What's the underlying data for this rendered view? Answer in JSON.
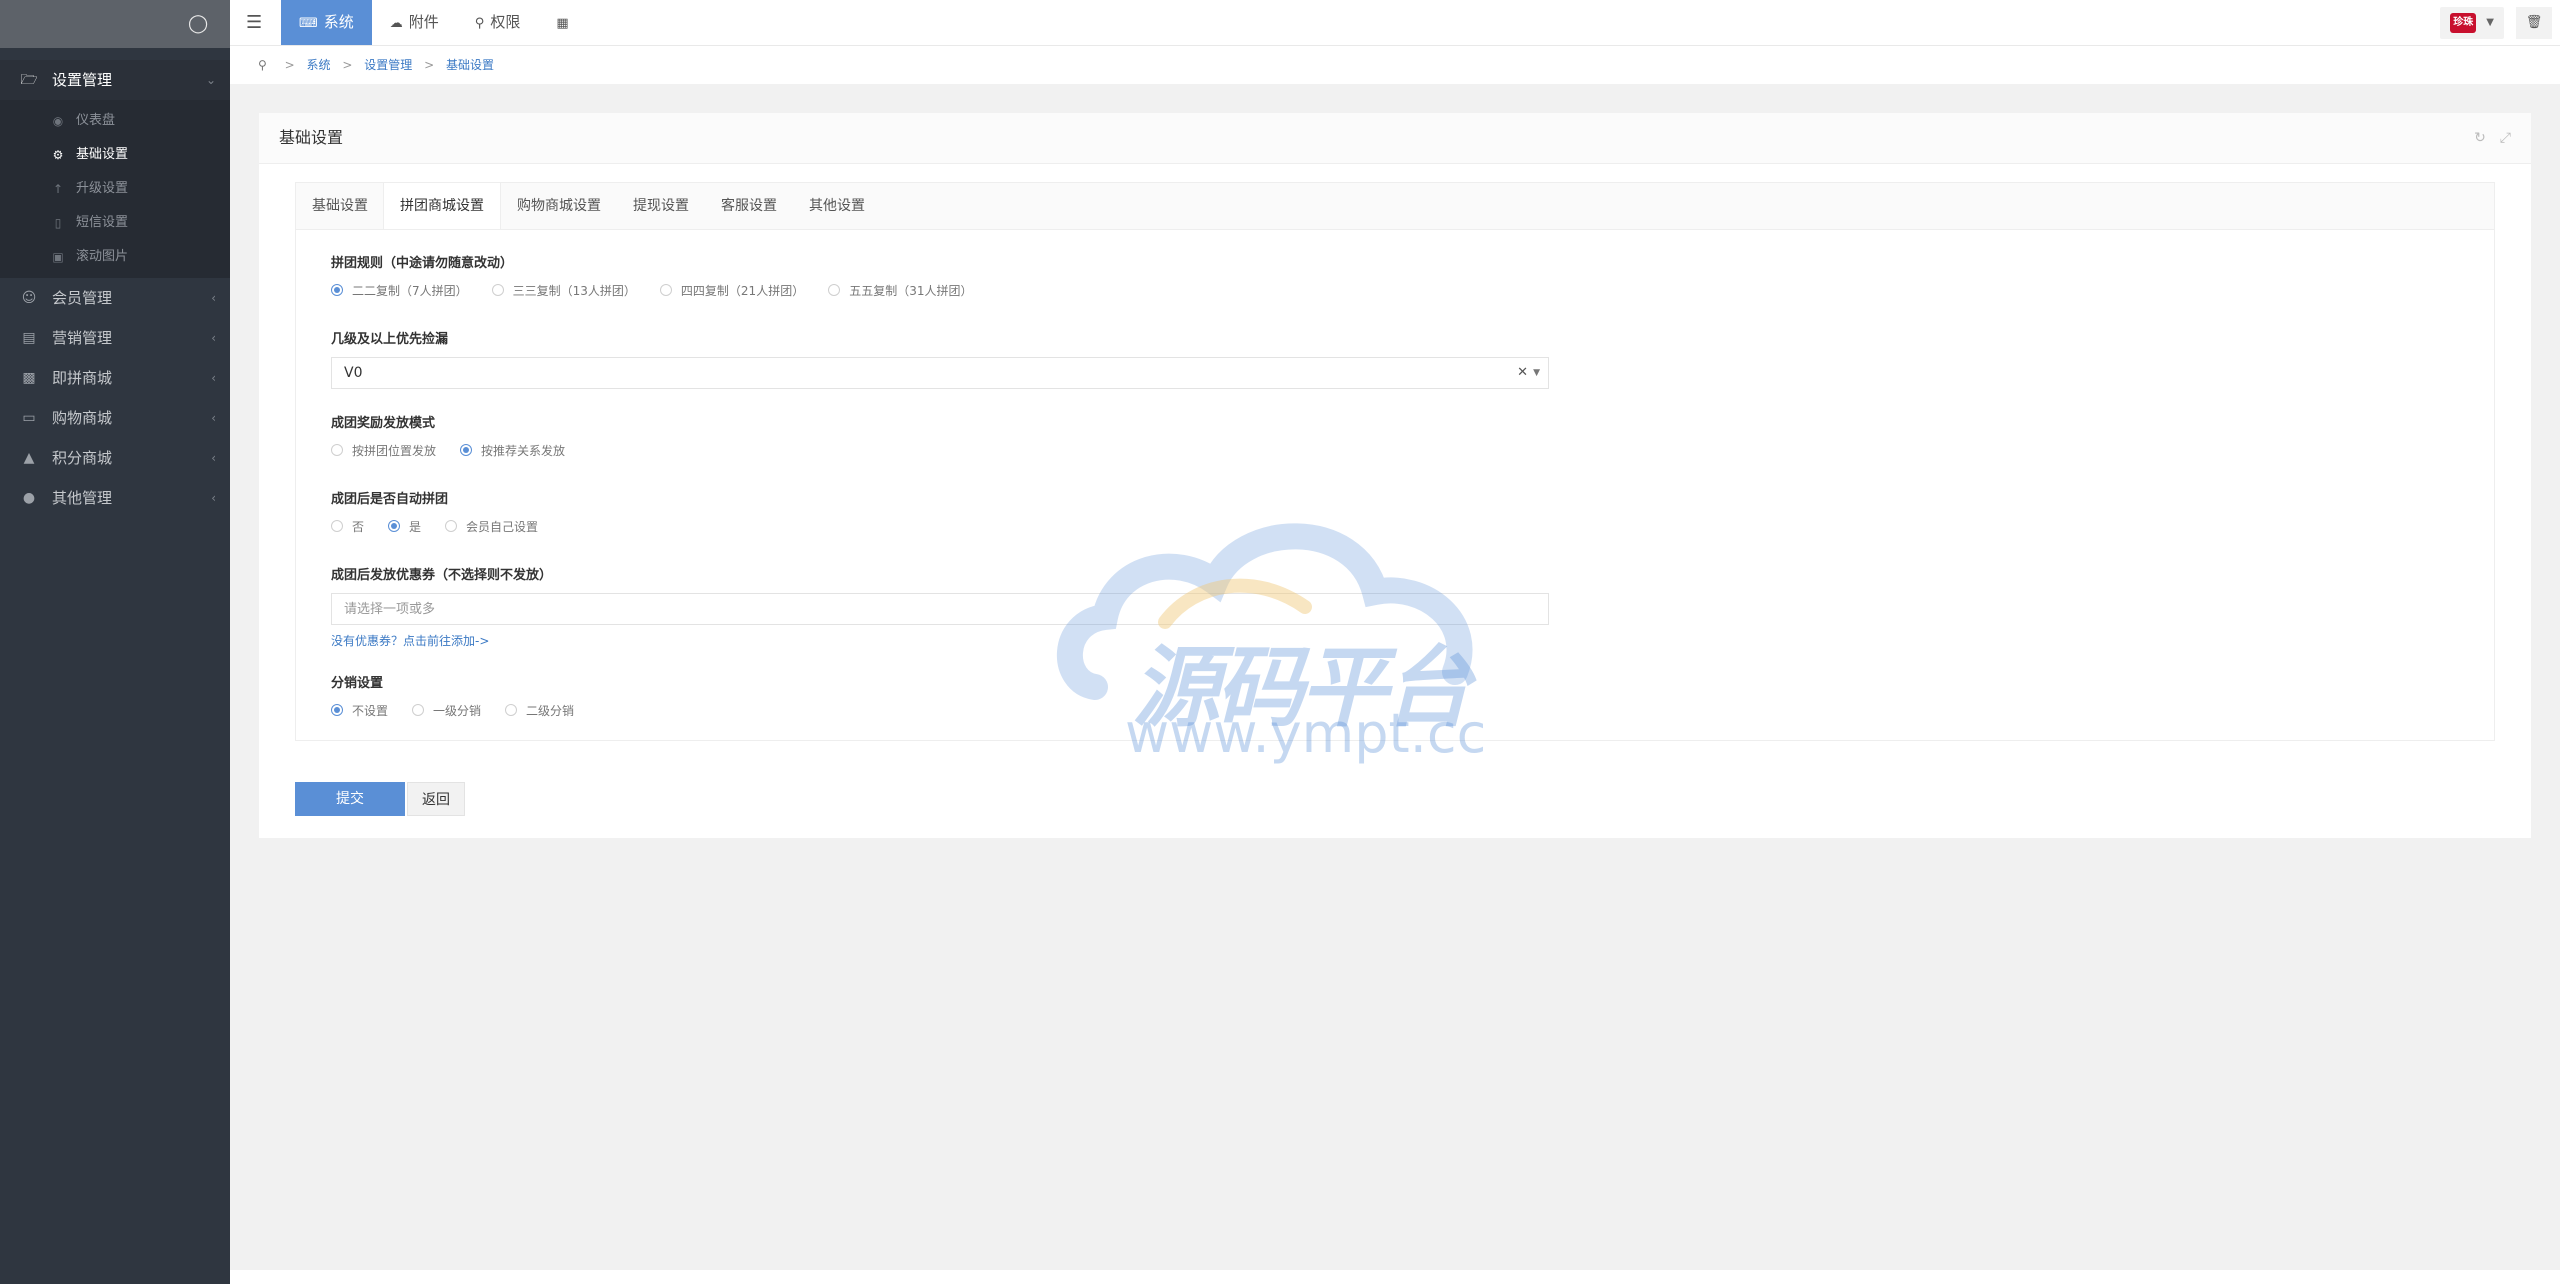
{
  "sidebar": {
    "groups": [
      {
        "label": "设置管理",
        "icon": "folder-open-icon"
      },
      {
        "label": "会员管理",
        "icon": "user-icon"
      },
      {
        "label": "营销管理",
        "icon": "money-icon"
      },
      {
        "label": "即拼商城",
        "icon": "bank-icon"
      },
      {
        "label": "购物商城",
        "icon": "cart-icon"
      },
      {
        "label": "积分商城",
        "icon": "building-icon"
      },
      {
        "label": "其他管理",
        "icon": "chat-icon"
      }
    ],
    "sub_items": [
      {
        "label": "仪表盘",
        "icon": "dashboard-icon"
      },
      {
        "label": "基础设置",
        "icon": "gear-icon"
      },
      {
        "label": "升级设置",
        "icon": "arrow-up-icon"
      },
      {
        "label": "短信设置",
        "icon": "phone-icon"
      },
      {
        "label": "滚动图片",
        "icon": "image-icon"
      }
    ]
  },
  "topbar": {
    "nav": [
      {
        "label": "系统",
        "icon": "keyboard-icon"
      },
      {
        "label": "附件",
        "icon": "cloud-icon"
      },
      {
        "label": "权限",
        "icon": "key-icon"
      },
      {
        "label": "",
        "icon": "grid-icon"
      }
    ],
    "avatar_text": "珍珠"
  },
  "breadcrumb": [
    "系统",
    "设置管理",
    "基础设置"
  ],
  "panel": {
    "title": "基础设置",
    "tabs": [
      "基础设置",
      "拼团商城设置",
      "购物商城设置",
      "提现设置",
      "客服设置",
      "其他设置"
    ],
    "fields": {
      "rule": {
        "label": "拼团规则（中途请勿随意改动）",
        "options": [
          "二二复制（7人拼团）",
          "三三复制（13人拼团）",
          "四四复制（21人拼团）",
          "五五复制（31人拼团）"
        ],
        "selected": 0
      },
      "level": {
        "label": "几级及以上优先捡漏",
        "value": "V0"
      },
      "reward": {
        "label": "成团奖励发放模式",
        "options": [
          "按拼团位置发放",
          "按推荐关系发放"
        ],
        "selected": 1
      },
      "auto": {
        "label": "成团后是否自动拼团",
        "options": [
          "否",
          "是",
          "会员自己设置"
        ],
        "selected": 1
      },
      "coupon": {
        "label": "成团后发放优惠券（不选择则不发放）",
        "placeholder": "请选择一项或多",
        "help": "没有优惠券？点击前往添加->"
      },
      "distribution": {
        "label": "分销设置",
        "options": [
          "不设置",
          "一级分销",
          "二级分销"
        ],
        "selected": 0
      }
    },
    "submit_label": "提交",
    "back_label": "返回"
  },
  "watermark": {
    "title": "源码平台",
    "url": "www.ympt.cc"
  },
  "colors": {
    "accent": "#5a8fd6",
    "sidebar": "#2f3640",
    "link": "#3b79c4"
  }
}
